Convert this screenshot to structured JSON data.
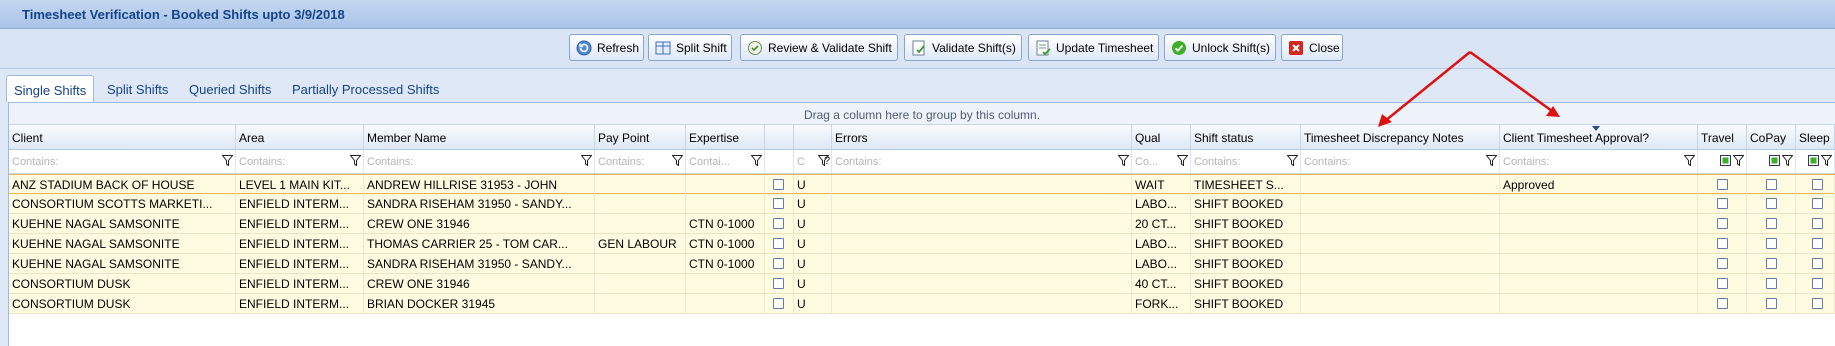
{
  "window": {
    "title": "Timesheet Verification - Booked  Shifts  upto 3/9/2018"
  },
  "toolbar": {
    "buttons": [
      {
        "label": "Refresh",
        "icon": "refresh-icon"
      },
      {
        "label": "Split Shift",
        "icon": "split-icon"
      },
      {
        "label": "Review & Validate Shift",
        "icon": "review-icon"
      },
      {
        "label": "Validate Shift(s)",
        "icon": "validate-icon"
      },
      {
        "label": "Update Timesheet",
        "icon": "update-icon"
      },
      {
        "label": "Unlock Shift(s)",
        "icon": "check-circle-icon"
      },
      {
        "label": "Close",
        "icon": "close-icon"
      }
    ]
  },
  "tabs": [
    "Single Shifts",
    "Split Shifts",
    "Queried Shifts",
    "Partially Processed Shifts"
  ],
  "grid": {
    "group_hint": "Drag a column here to group by this column.",
    "columns": [
      "Client",
      "Area",
      "Member Name",
      "Pay Point",
      "Expertise",
      "",
      "",
      "Errors",
      "Qual",
      "Shift status",
      "Timesheet Discrepancy Notes",
      "Client Timesheet Approval?",
      "Travel",
      "CoPay",
      "Sleep"
    ],
    "filter_placeholders": [
      "Contains:",
      "Contains:",
      "Contains:",
      "Contains:",
      "Contai...",
      "",
      "C",
      "Contains:",
      "Co...",
      "Contains:",
      "Contains:",
      "Contains:",
      "",
      "",
      ""
    ],
    "rows": [
      {
        "client": "ANZ STADIUM BACK OF HOUSE",
        "area": "LEVEL 1 MAIN KIT...",
        "member": "ANDREW HILLRISE 31953 - JOHN",
        "paypoint": "",
        "expertise": "",
        "u": "U",
        "errors": "",
        "qual": "WAIT",
        "status": "TIMESHEET  S...",
        "notes": "",
        "approval": "Approved"
      },
      {
        "client": "CONSORTIUM  SCOTTS  MARKETI...",
        "area": "ENFIELD  INTERM...",
        "member": "SANDRA RISEHAM 31950 - SANDY...",
        "paypoint": "",
        "expertise": "",
        "u": "U",
        "errors": "",
        "qual": "LABO...",
        "status": "SHIFT BOOKED",
        "notes": "",
        "approval": ""
      },
      {
        "client": "KUEHNE NAGAL SAMSONITE",
        "area": "ENFIELD  INTERM...",
        "member": "CREW ONE 31946",
        "paypoint": "",
        "expertise": "CTN 0-1000",
        "u": "U",
        "errors": "",
        "qual": "20 CT...",
        "status": "SHIFT BOOKED",
        "notes": "",
        "approval": ""
      },
      {
        "client": "KUEHNE NAGAL SAMSONITE",
        "area": "ENFIELD  INTERM...",
        "member": "THOMAS CARRIER 25 - TOM CAR...",
        "paypoint": "GEN LABOUR",
        "expertise": "CTN 0-1000",
        "u": "U",
        "errors": "",
        "qual": "LABO...",
        "status": "SHIFT BOOKED",
        "notes": "",
        "approval": ""
      },
      {
        "client": "KUEHNE NAGAL SAMSONITE",
        "area": "ENFIELD  INTERM...",
        "member": "SANDRA RISEHAM 31950 - SANDY...",
        "paypoint": "",
        "expertise": "CTN 0-1000",
        "u": "U",
        "errors": "",
        "qual": "LABO...",
        "status": "SHIFT BOOKED",
        "notes": "",
        "approval": ""
      },
      {
        "client": "CONSORTIUM DUSK",
        "area": "ENFIELD  INTERM...",
        "member": "CREW ONE 31946",
        "paypoint": "",
        "expertise": "",
        "u": "U",
        "errors": "",
        "qual": "40 CT...",
        "status": "SHIFT BOOKED",
        "notes": "",
        "approval": ""
      },
      {
        "client": "CONSORTIUM DUSK",
        "area": "ENFIELD  INTERM...",
        "member": "BRIAN DOCKER 31945",
        "paypoint": "",
        "expertise": "",
        "u": "U",
        "errors": "",
        "qual": "FORK...",
        "status": "SHIFT BOOKED",
        "notes": "",
        "approval": ""
      }
    ]
  },
  "colors": {
    "accent": "#15428b",
    "row_bg": "#fffbe0",
    "annotation_arrow": "#e01010"
  }
}
